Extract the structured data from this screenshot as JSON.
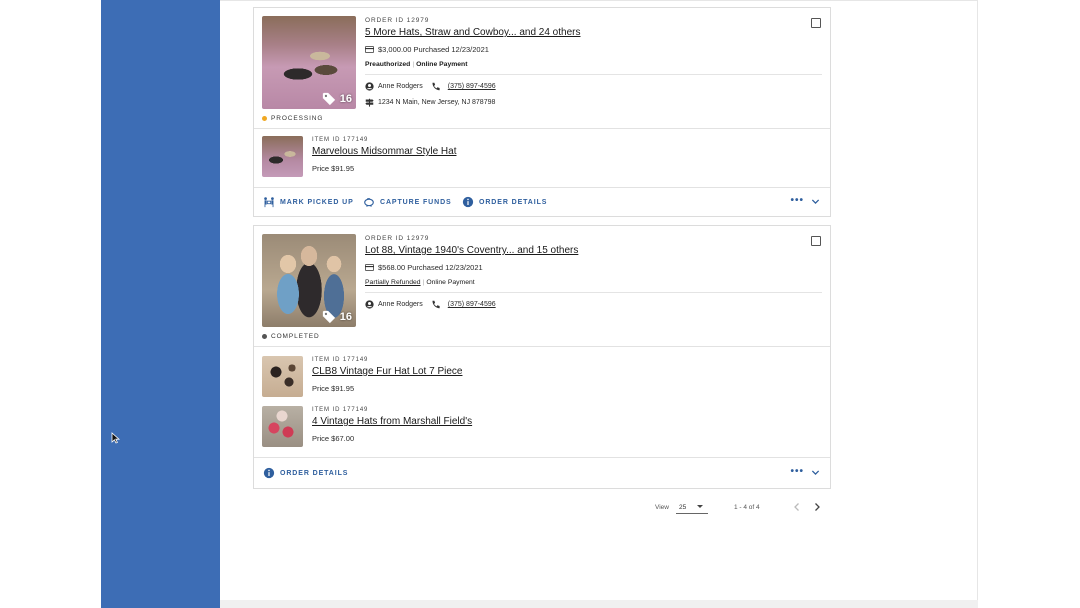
{
  "orders": [
    {
      "order_id": "ORDER ID 12979",
      "title": "5 More Hats, Straw and Cowboy... and 24 others",
      "image_count": "16",
      "price_line": "$3,000.00 Purchased 12/23/2021",
      "payment_status": "Preauthorized",
      "payment_method": "Online Payment",
      "customer_name": "Anne Rodgers",
      "customer_phone": "(375) 897-4596",
      "address": "1234 N Main, New Jersey, NJ 878798",
      "status": "PROCESSING",
      "status_color": "#f0a823",
      "items": [
        {
          "item_id": "ITEM ID 177149",
          "title": "Marvelous Midsommar Style Hat",
          "price": "Price $91.95"
        }
      ],
      "actions": {
        "mark_picked_up": "MARK PICKED UP",
        "capture_funds": "CAPTURE FUNDS",
        "order_details": "ORDER DETAILS"
      }
    },
    {
      "order_id": "ORDER ID 12979",
      "title": "Lot 88, Vintage 1940's Coventry... and 15 others",
      "image_count": "16",
      "price_line": "$568.00 Purchased 12/23/2021",
      "payment_status": "Partially Refunded",
      "payment_method": "Online Payment",
      "customer_name": "Anne Rodgers",
      "customer_phone": "(375) 897-4596",
      "status": "COMPLETED",
      "status_color": "#555555",
      "items": [
        {
          "item_id": "ITEM ID 177149",
          "title": "CLB8 Vintage Fur Hat Lot 7 Piece",
          "price": "Price $91.95"
        },
        {
          "item_id": "ITEM ID 177149",
          "title": "4 Vintage Hats from Marshall Field's",
          "price": "Price $67.00"
        }
      ],
      "actions": {
        "order_details": "ORDER DETAILS"
      }
    }
  ],
  "more_menu": "•••",
  "pagination": {
    "view_label": "View",
    "per_page": "25",
    "range": "1 - 4 of 4"
  },
  "colors": {
    "sidebar": "#3d6db5",
    "accent": "#2f5f9e"
  }
}
